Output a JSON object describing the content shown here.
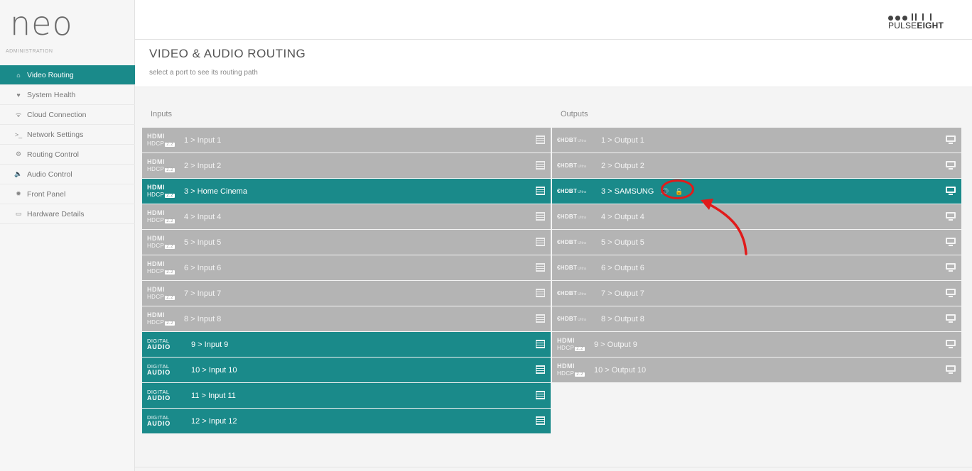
{
  "app": {
    "logo": "neo",
    "brand_dots": "●●||||",
    "brand_main": "PULSE",
    "brand_bold": "EIGHT"
  },
  "sidebar": {
    "section_label": "ADMINISTRATION",
    "items": [
      {
        "label": "Video Routing",
        "icon": "home-icon",
        "glyph": "⌂",
        "active": true
      },
      {
        "label": "System Health",
        "icon": "heart-icon",
        "glyph": "♥",
        "active": false
      },
      {
        "label": "Cloud Connection",
        "icon": "wifi-icon",
        "glyph": "ᯤ",
        "active": false
      },
      {
        "label": "Network Settings",
        "icon": "terminal-icon",
        "glyph": ">_",
        "active": false
      },
      {
        "label": "Routing Control",
        "icon": "gears-icon",
        "glyph": "⚙",
        "active": false
      },
      {
        "label": "Audio Control",
        "icon": "volume-icon",
        "glyph": "🔈",
        "active": false
      },
      {
        "label": "Front Panel",
        "icon": "sun-icon",
        "glyph": "✹",
        "active": false
      },
      {
        "label": "Hardware Details",
        "icon": "hdd-icon",
        "glyph": "▭",
        "active": false
      }
    ]
  },
  "page": {
    "title": "VIDEO & AUDIO ROUTING",
    "subtitle": "select a port to see its routing path",
    "inputs_label": "Inputs",
    "outputs_label": "Outputs"
  },
  "logos": {
    "hdmi": "HDMI",
    "hdcp": "HDCP",
    "hdcp_badge": "2.2",
    "digital": "DIGITAL",
    "audio": "AUDIO",
    "hdbt": "HDBT",
    "hdbt_suffix": "Ultra"
  },
  "inputs": [
    {
      "label": "1 > Input 1",
      "type": "hdmi",
      "state": "normal"
    },
    {
      "label": "2 > Input 2",
      "type": "hdmi",
      "state": "normal"
    },
    {
      "label": "3 > Home Cinema",
      "type": "hdmi",
      "state": "active"
    },
    {
      "label": "4 > Input 4",
      "type": "hdmi",
      "state": "normal"
    },
    {
      "label": "5 > Input 5",
      "type": "hdmi",
      "state": "normal"
    },
    {
      "label": "6 > Input 6",
      "type": "hdmi",
      "state": "normal"
    },
    {
      "label": "7 > Input 7",
      "type": "hdmi",
      "state": "normal"
    },
    {
      "label": "8 > Input 8",
      "type": "hdmi",
      "state": "normal"
    },
    {
      "label": "9 > Input 9",
      "type": "audio",
      "state": "digital"
    },
    {
      "label": "10 > Input 10",
      "type": "audio",
      "state": "digital"
    },
    {
      "label": "11 > Input 11",
      "type": "audio",
      "state": "digital"
    },
    {
      "label": "12 > Input 12",
      "type": "audio",
      "state": "digital"
    }
  ],
  "outputs": [
    {
      "label": "1 > Output 1",
      "type": "hdbt",
      "state": "normal"
    },
    {
      "label": "2 > Output 2",
      "type": "hdbt",
      "state": "normal"
    },
    {
      "label": "3 > SAMSUNG",
      "type": "hdbt",
      "state": "active",
      "indicators": "🔊 🔓"
    },
    {
      "label": "4 > Output 4",
      "type": "hdbt",
      "state": "normal"
    },
    {
      "label": "5 > Output 5",
      "type": "hdbt",
      "state": "normal"
    },
    {
      "label": "6 > Output 6",
      "type": "hdbt",
      "state": "normal"
    },
    {
      "label": "7 > Output 7",
      "type": "hdbt",
      "state": "normal"
    },
    {
      "label": "8 > Output 8",
      "type": "hdbt",
      "state": "normal"
    },
    {
      "label": "9 > Output 9",
      "type": "hdmi",
      "state": "normal"
    },
    {
      "label": "10 > Output 10",
      "type": "hdmi",
      "state": "normal"
    }
  ],
  "colors": {
    "accent": "#1a8a8a",
    "inactive_row": "#b4b4b4",
    "annotation": "#e01b1b"
  }
}
